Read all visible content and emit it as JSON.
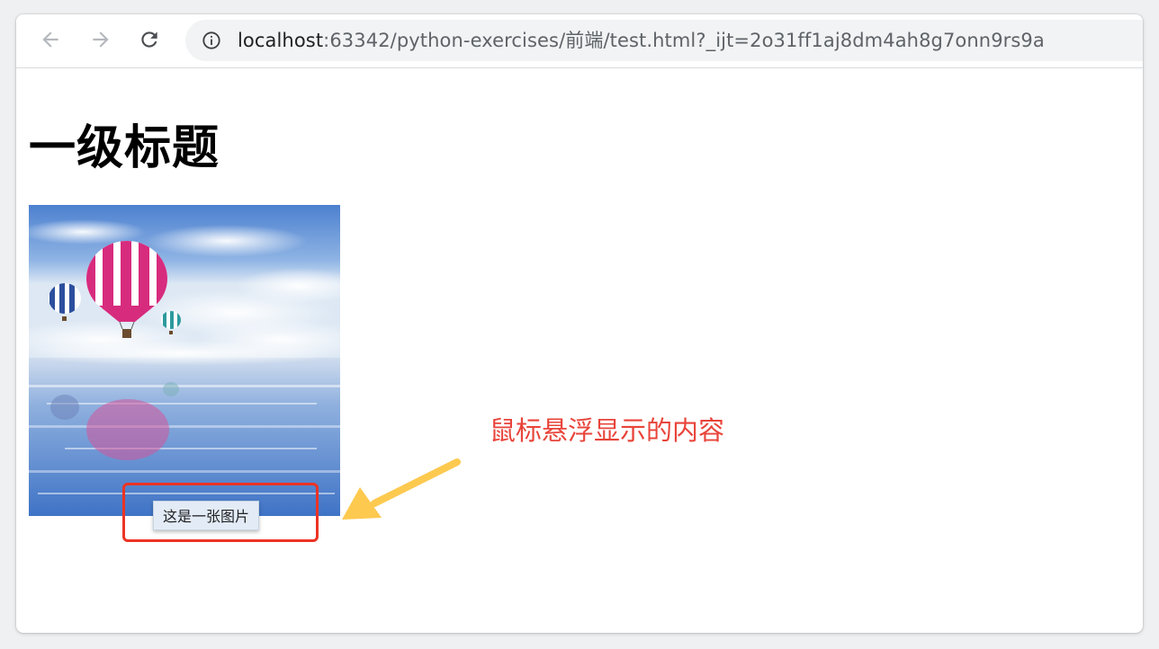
{
  "browser": {
    "url_host": "localhost",
    "url_rest": ":63342/python-exercises/前端/test.html?_ijt=2o31ff1aj8dm4ah8g7onn9rs9a",
    "icons": {
      "back": "arrow-left-icon",
      "forward": "arrow-right-icon",
      "reload": "reload-icon",
      "site_info": "info-circle-icon"
    }
  },
  "page": {
    "heading": "一级标题",
    "image_tooltip": "这是一张图片"
  },
  "annotation": {
    "text": "鼠标悬浮显示的内容",
    "text_color": "#e8443a",
    "box_color": "#ec3324",
    "arrow_color": "#fdc94f"
  }
}
